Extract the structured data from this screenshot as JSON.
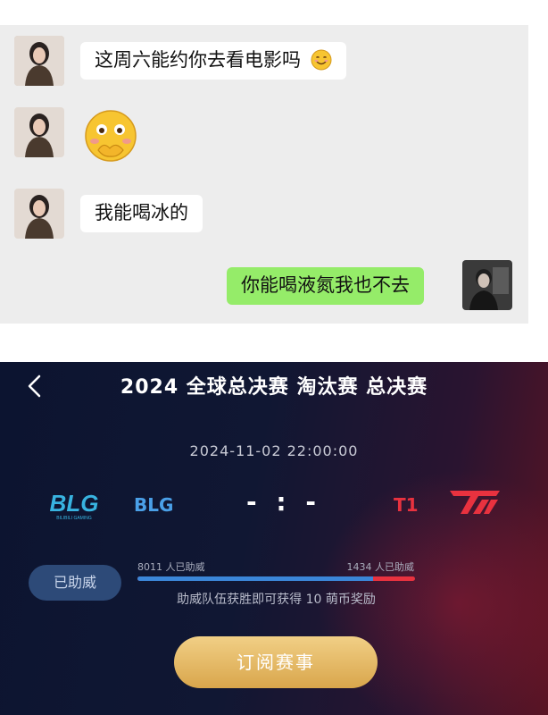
{
  "chat": {
    "messages": [
      {
        "side": "left",
        "text": "这周六能约你去看电影吗",
        "emoji": "smiling-face"
      },
      {
        "side": "left",
        "text": "",
        "emoji": "flushed-face-with-hands"
      },
      {
        "side": "left",
        "text": "我能喝冰的"
      },
      {
        "side": "right",
        "text": "你能喝液氮我也不去"
      }
    ]
  },
  "match": {
    "title": "2024 全球总决赛 淘汰赛 总决赛",
    "datetime": "2024-11-02 22:00:00",
    "team_left": {
      "name": "BLG",
      "logo_text": "BLG",
      "logo_sub": "BILIBILI GAMING",
      "color": "#4aa0e8"
    },
    "team_right": {
      "name": "T1",
      "color": "#e8323f"
    },
    "score": "- : -",
    "cheer_button": "已助威",
    "support_left": "8011 人已助威",
    "support_right": "1434 人已助威",
    "support_left_fraction": 0.848,
    "reward_text": "助威队伍获胜即可获得 10 萌币奖励",
    "subscribe_button": "订阅赛事"
  }
}
